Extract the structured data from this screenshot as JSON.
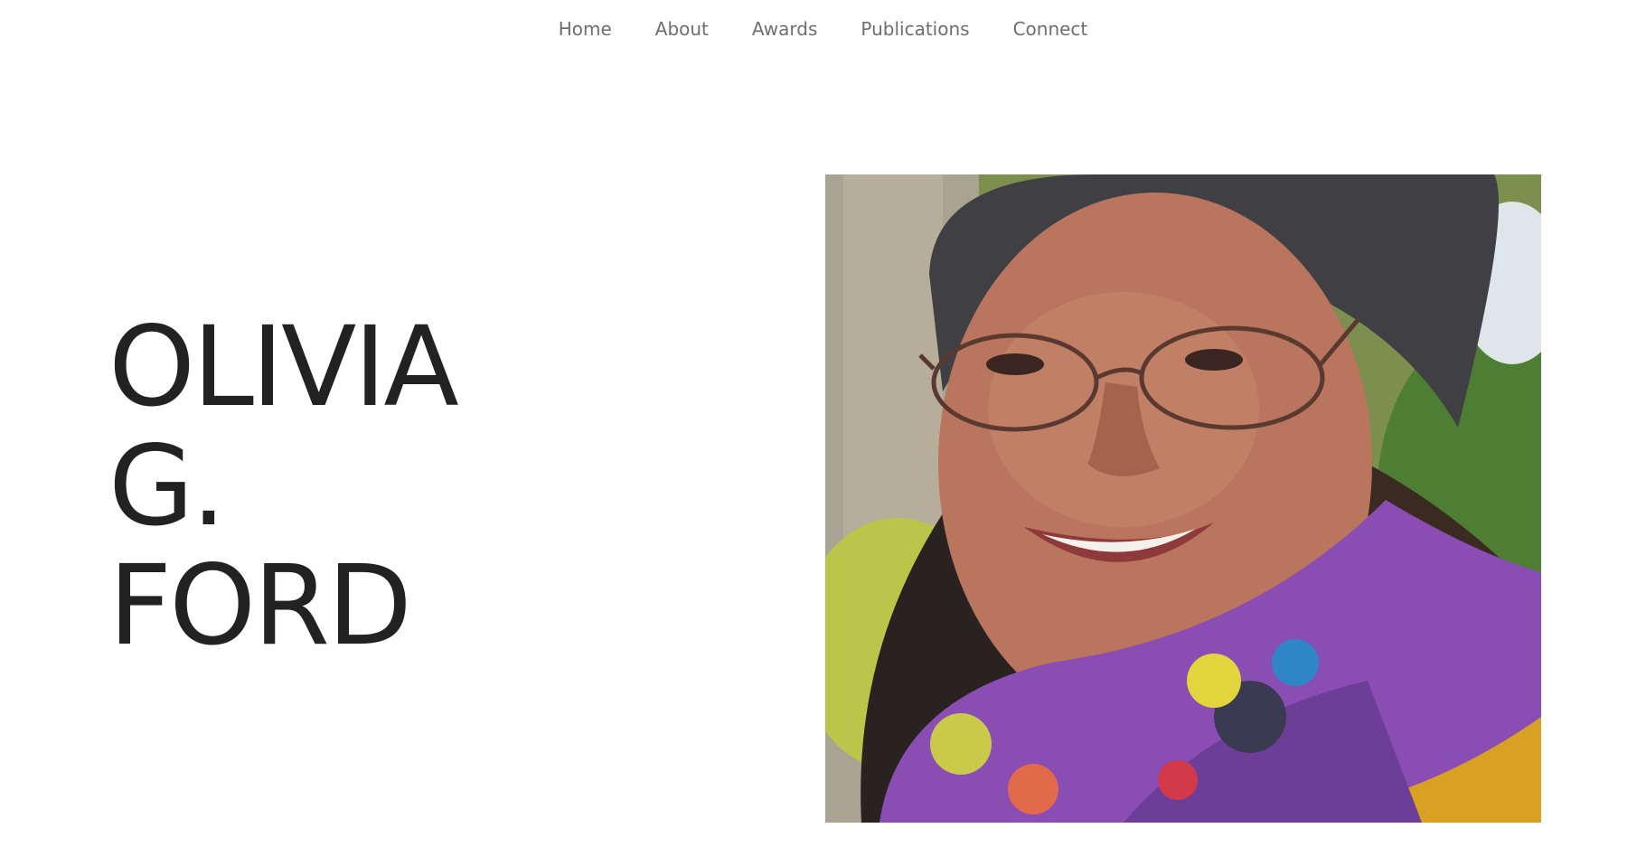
{
  "nav": {
    "items": [
      {
        "label": "Home"
      },
      {
        "label": "About"
      },
      {
        "label": "Awards"
      },
      {
        "label": "Publications"
      },
      {
        "label": "Connect"
      }
    ]
  },
  "hero": {
    "name_lines": [
      "OLIVIA",
      "G.",
      "FORD"
    ]
  },
  "portrait": {
    "alt": "Portrait photo"
  },
  "colors": {
    "text": "#222222",
    "nav_text": "#6e6e6e",
    "background": "#ffffff"
  }
}
